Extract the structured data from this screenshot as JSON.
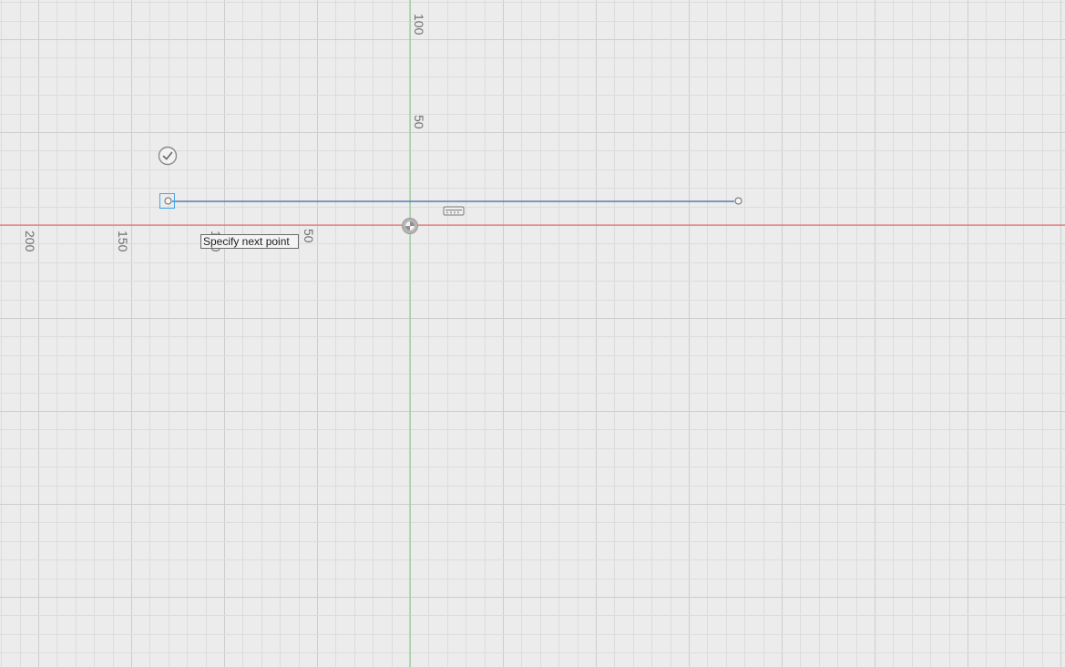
{
  "sketch": {
    "prompt_text": "Specify next point",
    "colors": {
      "background": "#ececec",
      "grid_minor": "#dcdcdc",
      "grid_major": "#cdcdcd",
      "x_axis": "#e05a5a",
      "y_axis": "#8fd08f",
      "line": "#5b78b8",
      "selection": "#4aa6e8",
      "label": "#6e6e6e"
    },
    "x_axis_labels": [
      "200",
      "150",
      "100",
      "50"
    ],
    "y_axis_labels": [
      "100",
      "50"
    ],
    "icons": {
      "finish": "check-circle-icon",
      "constraint": "horizontal-constraint-icon",
      "origin": "origin-icon"
    }
  }
}
